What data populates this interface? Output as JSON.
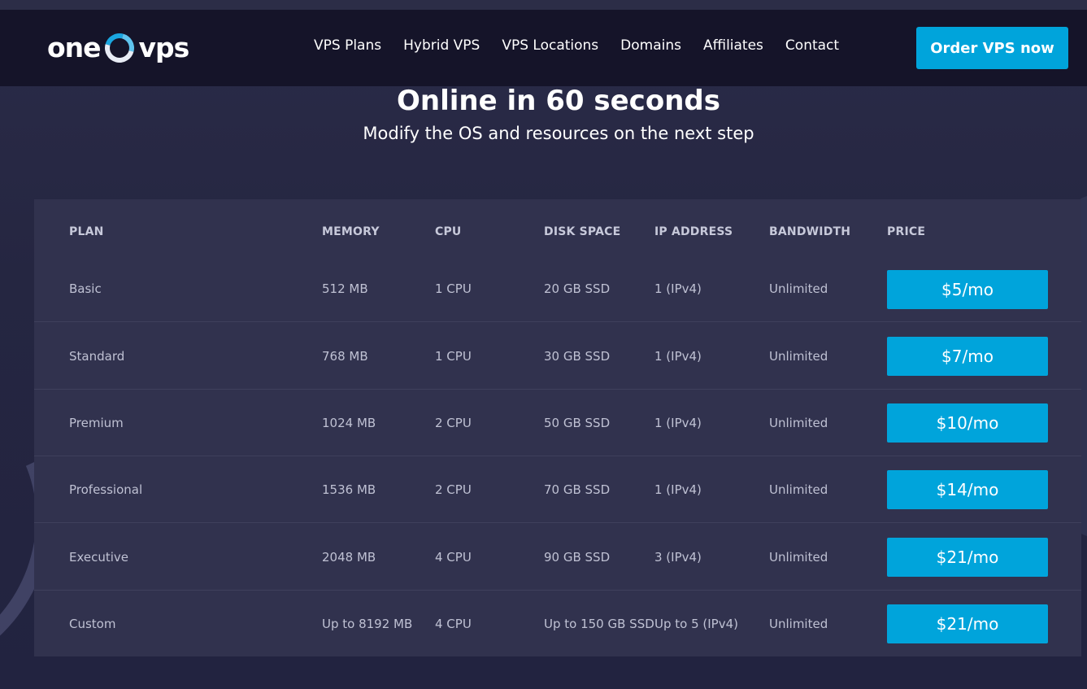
{
  "brand": {
    "name_left": "one",
    "name_right": "vps"
  },
  "nav": {
    "items": [
      {
        "label": "VPS Plans"
      },
      {
        "label": "Hybrid VPS"
      },
      {
        "label": "VPS Locations"
      },
      {
        "label": "Domains"
      },
      {
        "label": "Affiliates"
      },
      {
        "label": "Contact"
      }
    ],
    "cta": "Order VPS now"
  },
  "hero": {
    "title": "Online in 60 seconds",
    "subtitle": "Modify the OS and resources on the next step"
  },
  "table": {
    "headers": {
      "plan": "PLAN",
      "memory": "MEMORY",
      "cpu": "CPU",
      "disk": "DISK SPACE",
      "ip": "IP ADDRESS",
      "bandwidth": "BANDWIDTH",
      "price": "PRICE"
    },
    "rows": [
      {
        "plan": "Basic",
        "memory": "512 MB",
        "cpu": "1 CPU",
        "disk": "20 GB SSD",
        "ip": "1 (IPv4)",
        "bandwidth": "Unlimited",
        "price": "$5/mo"
      },
      {
        "plan": "Standard",
        "memory": "768 MB",
        "cpu": "1 CPU",
        "disk": "30 GB SSD",
        "ip": "1 (IPv4)",
        "bandwidth": "Unlimited",
        "price": "$7/mo"
      },
      {
        "plan": "Premium",
        "memory": "1024 MB",
        "cpu": "2 CPU",
        "disk": "50 GB SSD",
        "ip": "1 (IPv4)",
        "bandwidth": "Unlimited",
        "price": "$10/mo"
      },
      {
        "plan": "Professional",
        "memory": "1536 MB",
        "cpu": "2 CPU",
        "disk": "70 GB SSD",
        "ip": "1 (IPv4)",
        "bandwidth": "Unlimited",
        "price": "$14/mo"
      },
      {
        "plan": "Executive",
        "memory": "2048 MB",
        "cpu": "4 CPU",
        "disk": "90 GB SSD",
        "ip": "3 (IPv4)",
        "bandwidth": "Unlimited",
        "price": "$21/mo"
      },
      {
        "plan": "Custom",
        "memory": "Up to 8192 MB",
        "cpu": "4 CPU",
        "disk": "Up to 150 GB SSD",
        "ip": "Up to 5 (IPv4)",
        "bandwidth": "Unlimited",
        "price": "$21/mo"
      }
    ]
  },
  "colors": {
    "accent": "#00a4db",
    "header_bg": "#151429",
    "page_bg": "#24253f",
    "panel_bg": "#31324e"
  }
}
